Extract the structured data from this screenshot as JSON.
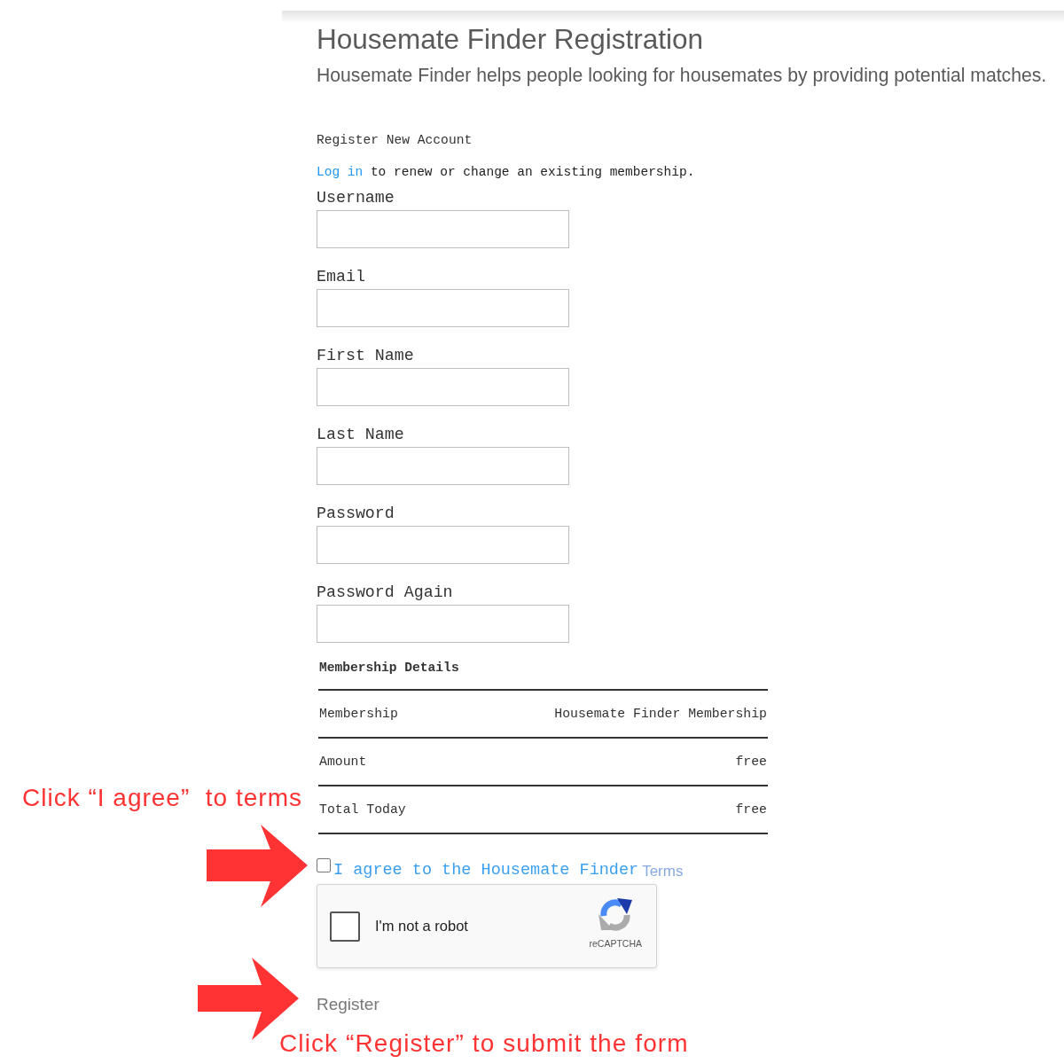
{
  "page": {
    "title": "Housemate Finder Registration",
    "description": "Housemate Finder helps people looking for housemates by providing potential matches."
  },
  "account": {
    "heading": "Register New Account",
    "login_note": {
      "link": "Log in",
      "text": "to renew or change an existing membership."
    },
    "fields": [
      {
        "label": "Username"
      },
      {
        "label": "Email"
      },
      {
        "label": "First Name"
      },
      {
        "label": "Last Name"
      },
      {
        "label": "Password"
      },
      {
        "label": "Password Again"
      }
    ]
  },
  "membership_details": {
    "heading": "Membership Details",
    "rows": [
      {
        "label": "Membership",
        "value": "Housemate Finder Membership"
      },
      {
        "label": "Amount",
        "value": "free"
      },
      {
        "label": "Total Today",
        "value": "free"
      }
    ]
  },
  "terms": {
    "checked": false,
    "text": "I agree to the Housemate Finder",
    "link": "Terms"
  },
  "captcha": {
    "checked": false,
    "label": "I'm not a robot",
    "brand": "reCAPTCHA"
  },
  "submit": {
    "label": "Register"
  },
  "annotations": [
    {
      "text": "Click “I agree”  to terms"
    },
    {
      "text": "Click “Register” to submit the form"
    }
  ]
}
